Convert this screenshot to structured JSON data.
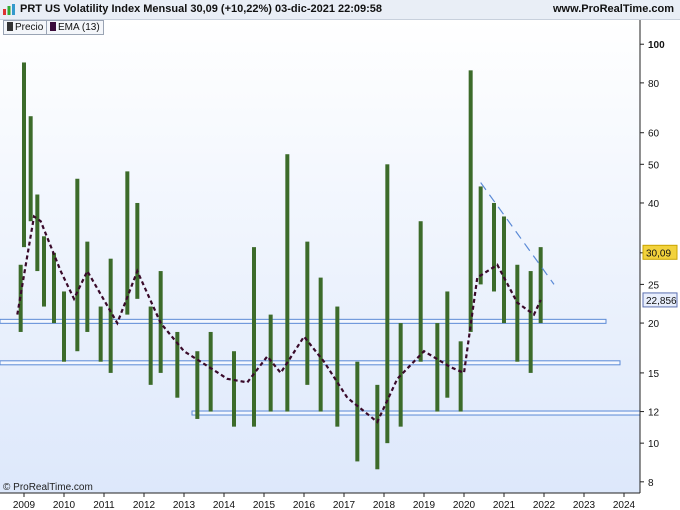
{
  "header": {
    "title": "PRT US Volatility Index Mensual 30,09 (+10,22%) 03-dic-2021 22:09:58",
    "site": "www.ProRealTime.com"
  },
  "legend": [
    {
      "label": "Precio",
      "color": "#333333"
    },
    {
      "label": "EMA (13)",
      "color": "#3a0a3a"
    }
  ],
  "watermark": "© ProRealTime.com",
  "colors": {
    "bars": "#3c6b2a",
    "ema": "#3a0a2a",
    "support": "#5b8ad6",
    "price_tag": "#f2d23c",
    "ema_tag": "#e8eefc"
  },
  "chart_data": {
    "type": "bar",
    "title": "PRT US Volatility Index Mensual",
    "y_scale": "log",
    "ylim": [
      7.5,
      115
    ],
    "y_ticks": [
      8,
      10,
      12,
      15,
      20,
      25,
      30,
      40,
      50,
      60,
      80,
      100
    ],
    "x_range": [
      "2008-11",
      "2024-06"
    ],
    "x_ticks": [
      "2009",
      "2010",
      "2011",
      "2012",
      "2013",
      "2014",
      "2015",
      "2016",
      "2017",
      "2018",
      "2019",
      "2020",
      "2021",
      "2022",
      "2023",
      "2024"
    ],
    "bars_sampled": [
      {
        "date": "2008-12",
        "low": 19,
        "high": 28
      },
      {
        "date": "2009-01",
        "low": 31,
        "high": 90
      },
      {
        "date": "2009-03",
        "low": 36,
        "high": 66
      },
      {
        "date": "2009-05",
        "low": 27,
        "high": 42
      },
      {
        "date": "2009-07",
        "low": 22,
        "high": 33
      },
      {
        "date": "2009-10",
        "low": 20,
        "high": 30
      },
      {
        "date": "2010-01",
        "low": 16,
        "high": 24
      },
      {
        "date": "2010-05",
        "low": 17,
        "high": 46
      },
      {
        "date": "2010-08",
        "low": 19,
        "high": 32
      },
      {
        "date": "2010-12",
        "low": 16,
        "high": 22
      },
      {
        "date": "2011-03",
        "low": 15,
        "high": 29
      },
      {
        "date": "2011-08",
        "low": 21,
        "high": 48
      },
      {
        "date": "2011-11",
        "low": 23,
        "high": 40
      },
      {
        "date": "2012-03",
        "low": 14,
        "high": 22
      },
      {
        "date": "2012-06",
        "low": 15,
        "high": 27
      },
      {
        "date": "2012-11",
        "low": 13,
        "high": 19
      },
      {
        "date": "2013-05",
        "low": 11.5,
        "high": 17
      },
      {
        "date": "2013-09",
        "low": 12,
        "high": 19
      },
      {
        "date": "2014-04",
        "low": 11,
        "high": 17
      },
      {
        "date": "2014-10",
        "low": 11,
        "high": 31
      },
      {
        "date": "2015-03",
        "low": 12,
        "high": 21
      },
      {
        "date": "2015-08",
        "low": 12,
        "high": 53
      },
      {
        "date": "2016-02",
        "low": 14,
        "high": 32
      },
      {
        "date": "2016-06",
        "low": 12,
        "high": 26
      },
      {
        "date": "2016-11",
        "low": 11,
        "high": 22
      },
      {
        "date": "2017-05",
        "low": 9,
        "high": 16
      },
      {
        "date": "2017-11",
        "low": 8.6,
        "high": 14
      },
      {
        "date": "2018-02",
        "low": 10,
        "high": 50
      },
      {
        "date": "2018-06",
        "low": 11,
        "high": 20
      },
      {
        "date": "2018-12",
        "low": 16,
        "high": 36
      },
      {
        "date": "2019-05",
        "low": 12,
        "high": 20
      },
      {
        "date": "2019-08",
        "low": 13,
        "high": 24
      },
      {
        "date": "2019-12",
        "low": 12,
        "high": 18
      },
      {
        "date": "2020-03",
        "low": 19,
        "high": 86
      },
      {
        "date": "2020-06",
        "low": 25,
        "high": 44
      },
      {
        "date": "2020-10",
        "low": 24,
        "high": 40
      },
      {
        "date": "2021-01",
        "low": 20,
        "high": 37
      },
      {
        "date": "2021-05",
        "low": 16,
        "high": 28
      },
      {
        "date": "2021-09",
        "low": 15,
        "high": 27
      },
      {
        "date": "2021-12",
        "low": 20,
        "high": 31
      }
    ],
    "ema_sampled": [
      {
        "date": "2008-11",
        "value": 21
      },
      {
        "date": "2009-04",
        "value": 37
      },
      {
        "date": "2009-06",
        "value": 36
      },
      {
        "date": "2009-12",
        "value": 27
      },
      {
        "date": "2010-04",
        "value": 23
      },
      {
        "date": "2010-08",
        "value": 27
      },
      {
        "date": "2011-05",
        "value": 20
      },
      {
        "date": "2011-11",
        "value": 27
      },
      {
        "date": "2012-06",
        "value": 20
      },
      {
        "date": "2013-01",
        "value": 17
      },
      {
        "date": "2013-06",
        "value": 16
      },
      {
        "date": "2014-02",
        "value": 14.5
      },
      {
        "date": "2014-08",
        "value": 14.2
      },
      {
        "date": "2015-02",
        "value": 16.5
      },
      {
        "date": "2015-06",
        "value": 15
      },
      {
        "date": "2016-01",
        "value": 18.5
      },
      {
        "date": "2016-07",
        "value": 16
      },
      {
        "date": "2017-02",
        "value": 13
      },
      {
        "date": "2017-11",
        "value": 11.3
      },
      {
        "date": "2018-05",
        "value": 14.5
      },
      {
        "date": "2019-01",
        "value": 17
      },
      {
        "date": "2019-09",
        "value": 15.5
      },
      {
        "date": "2020-01",
        "value": 15
      },
      {
        "date": "2020-05",
        "value": 26
      },
      {
        "date": "2020-11",
        "value": 28
      },
      {
        "date": "2021-05",
        "value": 22.5
      },
      {
        "date": "2021-10",
        "value": 21
      },
      {
        "date": "2021-12",
        "value": 22.856
      }
    ],
    "horizontal_lines": [
      20.2,
      15.9,
      11.9
    ],
    "trendline": [
      {
        "date": "2020-06",
        "value": 45
      },
      {
        "date": "2022-04",
        "value": 25
      }
    ],
    "last_price": {
      "label": "30,09",
      "value": 30.09
    },
    "ema_last": {
      "label": "22,856",
      "value": 22.856
    }
  }
}
